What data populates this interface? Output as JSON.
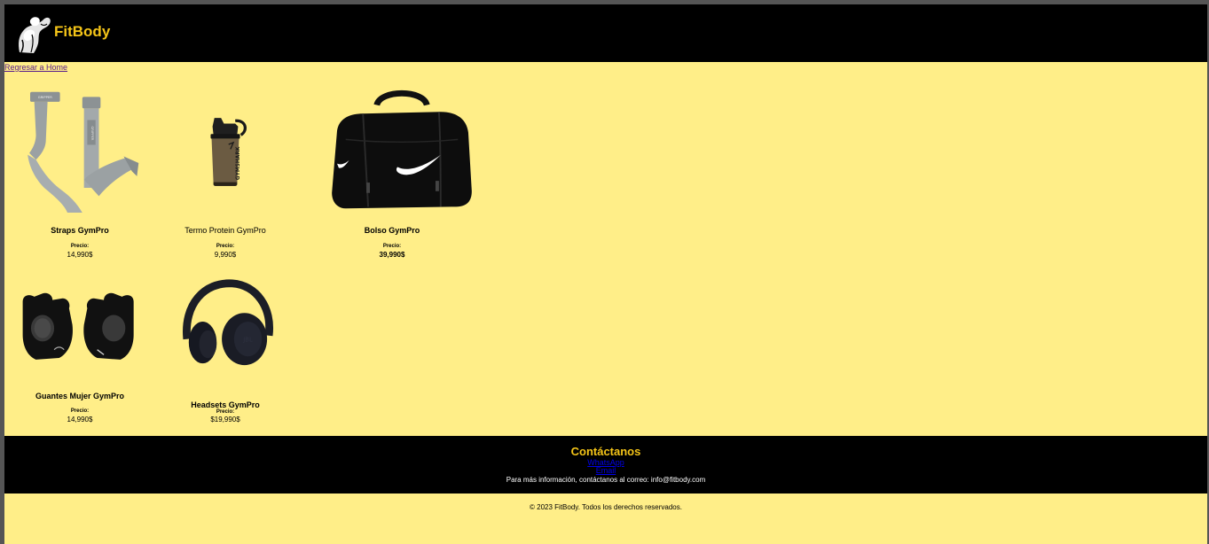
{
  "header": {
    "brand": "FitBody",
    "brand_color": "#f5c518"
  },
  "nav": {
    "back_label": "Regresar a Home"
  },
  "products": [
    {
      "name": "Straps GymPro",
      "price_label": "Precio:",
      "price": "14,990$",
      "icon": "lifting-straps-image"
    },
    {
      "name": "Termo Protein GymPro",
      "price_label": "Precio:",
      "price": "9,990$",
      "icon": "shaker-bottle-image",
      "image_text": "GYMSHARK"
    },
    {
      "name": "Bolso GymPro",
      "price_label": "Precio:",
      "price": "39,990$",
      "icon": "duffel-bag-image"
    },
    {
      "name": "Guantes Mujer GymPro",
      "price_label": "Precio:",
      "price": "14,990$",
      "icon": "gym-gloves-image"
    },
    {
      "name": "Headsets GymPro",
      "price_label": "Precio:",
      "price": "$19,990$",
      "icon": "headphones-image"
    }
  ],
  "footer": {
    "title": "Contáctanos",
    "links": [
      "WhatsApp",
      "Email"
    ],
    "note": "Para más información, contáctanos al correo: info@fitbody.com"
  },
  "copyright": "© 2023 FitBody. Todos los derechos reservados."
}
